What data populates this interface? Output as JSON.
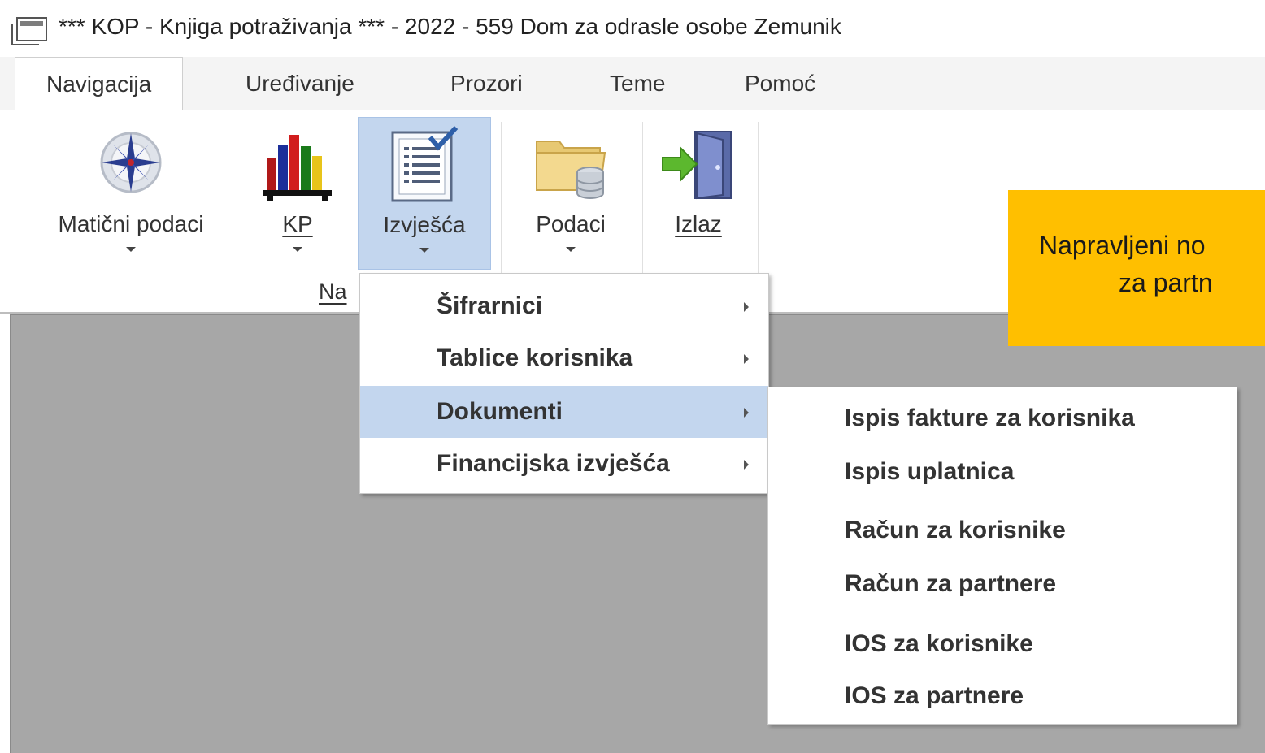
{
  "window": {
    "title": "*** KOP - Knjiga potraživanja *** - 2022 - 559 Dom za odrasle osobe Zemunik",
    "icon": "window-icon"
  },
  "tabs": [
    {
      "label": "Navigacija",
      "active": true
    },
    {
      "label": "Uređivanje",
      "active": false
    },
    {
      "label": "Prozori",
      "active": false
    },
    {
      "label": "Teme",
      "active": false
    },
    {
      "label": "Pomoć",
      "active": false
    }
  ],
  "ribbon": {
    "buttons": [
      {
        "label": "Matični podaci",
        "icon": "compass-icon",
        "dropdown": true
      },
      {
        "label": "KP",
        "icon": "books-chart-icon",
        "dropdown": true
      },
      {
        "label": "Izvješća",
        "icon": "report-checklist-icon",
        "dropdown": true,
        "selected": true
      },
      {
        "label": "Podaci",
        "icon": "folder-database-icon",
        "dropdown": true
      },
      {
        "label": "Izlaz",
        "icon": "exit-door-icon",
        "dropdown": false
      }
    ],
    "group_label": "Na"
  },
  "callout": {
    "line1": "Napravljeni no",
    "line2": "za partn",
    "color": "#ffbf00"
  },
  "menu_izvjesca": {
    "items": [
      {
        "label": "Šifrarnici",
        "submenu": true
      },
      {
        "label": "Tablice korisnika",
        "submenu": true
      },
      {
        "label": "Dokumenti",
        "submenu": true,
        "highlighted": true
      },
      {
        "label": "Financijska izvješća",
        "submenu": true
      }
    ]
  },
  "menu_dokumenti": {
    "items": [
      {
        "label": "Ispis fakture za korisnika"
      },
      {
        "label": "Ispis uplatnica"
      },
      {
        "label": "Račun za korisnike"
      },
      {
        "label": "Račun za partnere"
      },
      {
        "label": "IOS za korisnike"
      },
      {
        "label": "IOS za partnere"
      }
    ]
  },
  "colors": {
    "selection": "#c3d6ee",
    "workspace": "#a7a7a7"
  }
}
